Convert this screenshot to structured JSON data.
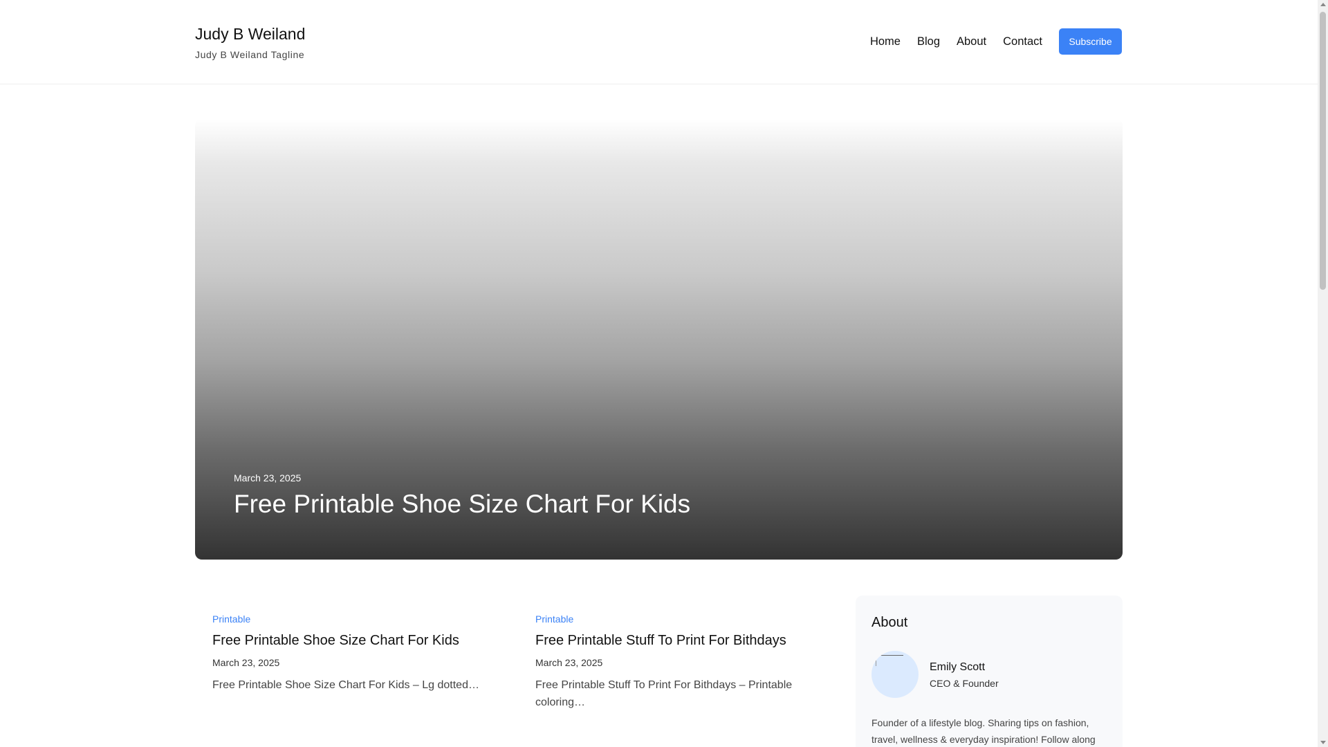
{
  "header": {
    "site_title": "Judy B Weiland",
    "tagline": "Judy B Weiland Tagline",
    "nav": [
      {
        "label": "Home"
      },
      {
        "label": "Blog"
      },
      {
        "label": "About"
      },
      {
        "label": "Contact"
      }
    ],
    "subscribe_label": "Subscribe"
  },
  "hero": {
    "date": "March 23, 2025",
    "title": "Free Printable Shoe Size Chart For Kids"
  },
  "posts": [
    {
      "category": "Printable",
      "title": "Free Printable Shoe Size Chart For Kids",
      "date": "March 23, 2025",
      "excerpt": "Free Printable Shoe Size Chart For Kids – Lg dotted…"
    },
    {
      "category": "Printable",
      "title": "Free Printable Stuff To Print For Bithdays",
      "date": "March 23, 2025",
      "excerpt": "Free Printable Stuff To Print For Bithdays – Printable coloring…"
    }
  ],
  "about": {
    "heading": "About",
    "author_name": "Emily Scott",
    "author_role": "CEO & Founder",
    "bio": "Founder of a lifestyle blog. Sharing tips on fashion, travel, wellness & everyday inspiration! Follow along"
  },
  "colors": {
    "accent": "#3b82f6"
  }
}
